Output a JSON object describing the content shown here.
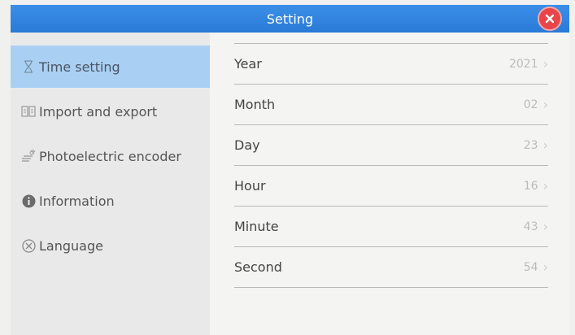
{
  "window": {
    "title": "Setting"
  },
  "sidebar": {
    "items": [
      {
        "label": "Time setting",
        "icon": "hourglass-icon",
        "active": true
      },
      {
        "label": "Import and export",
        "icon": "import-export-icon"
      },
      {
        "label": "Photoelectric encoder",
        "icon": "encoder-icon"
      },
      {
        "label": "Information",
        "icon": "info-icon"
      },
      {
        "label": "Language",
        "icon": "language-icon"
      }
    ]
  },
  "time_settings": {
    "rows": [
      {
        "label": "Year",
        "value": "2021"
      },
      {
        "label": "Month",
        "value": "02"
      },
      {
        "label": "Day",
        "value": "23"
      },
      {
        "label": "Hour",
        "value": "16"
      },
      {
        "label": "Minute",
        "value": "43"
      },
      {
        "label": "Second",
        "value": "54"
      }
    ]
  },
  "colors": {
    "titlebar": "#2a7ad8",
    "active_item": "#a9d0f3",
    "close": "#e8454b"
  }
}
